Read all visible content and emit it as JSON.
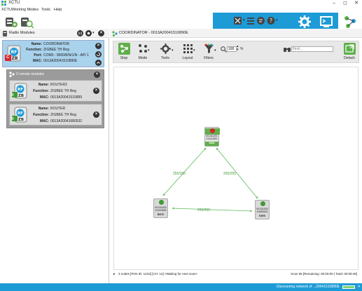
{
  "app": {
    "title": "XCTU",
    "window_controls": [
      "–",
      "◻",
      "✕"
    ]
  },
  "menu": [
    "XCTU",
    "Working Modes",
    "Tools",
    "Help"
  ],
  "left_panel": {
    "title": "Radio Modules",
    "coordinator": {
      "role_badge": "C",
      "fields": [
        {
          "label": "Name:",
          "value": "COORDINATOR"
        },
        {
          "label": "Function:",
          "value": "ZIGBEE TH Reg"
        },
        {
          "label": "Port:",
          "value": "COM3 - 9600/8/N/1/N - API 1"
        },
        {
          "label": "MAC:",
          "value": "0013A20041510890E"
        }
      ]
    },
    "remote_header": "2 remote modules",
    "remotes": [
      {
        "role_badge": "R",
        "fields": [
          {
            "label": "Name:",
            "value": "ROUTER2"
          },
          {
            "label": "Function:",
            "value": "ZIGBEE TH Reg"
          },
          {
            "label": "MAC:",
            "value": "0013A20041510899"
          }
        ]
      },
      {
        "role_badge": "R",
        "fields": [
          {
            "label": "Name:",
            "value": "ROUTER"
          },
          {
            "label": "Function:",
            "value": "ZIGBEE TH Reg"
          },
          {
            "label": "MAC:",
            "value": "0013A20041680532"
          }
        ]
      }
    ]
  },
  "right_panel": {
    "title": "COORDINATOR - 0013A20041510890E",
    "tools": [
      {
        "label": "Stop"
      },
      {
        "label": "Mode"
      },
      {
        "label": "Tools"
      },
      {
        "label": "Layout"
      },
      {
        "label": "Filters"
      }
    ],
    "zoom_value": "100",
    "zoom_unit": "%",
    "find_placeholder": "Find...",
    "detach_label": "Detach",
    "nodes": [
      {
        "id_top": "0013A200",
        "id_bot": "41510890",
        "name": "0000",
        "role": "C"
      },
      {
        "id_top": "0013A200",
        "id_bot": "41510899",
        "name": "BD70",
        "role": "R"
      },
      {
        "id_top": "0013A200",
        "id_bot": "41680532",
        "name": "E3E5",
        "role": "R"
      }
    ],
    "links": [
      "255/255",
      "255/255",
      "255/255"
    ],
    "status_left": "3 nodes [PAN ID: 1234] [CH: 14] <Waiting for next scan>",
    "status_right": "Scan 55 [Remaining: 00:00:00 | Total: 00:09:48]"
  },
  "footer": {
    "text": "Discovering network of ...20041510890E"
  },
  "colors": {
    "accent": "#1d9bd7",
    "coordinator_green": "#5fb04a",
    "router_green": "#3f9a36",
    "link_green": "#5cb85c"
  }
}
